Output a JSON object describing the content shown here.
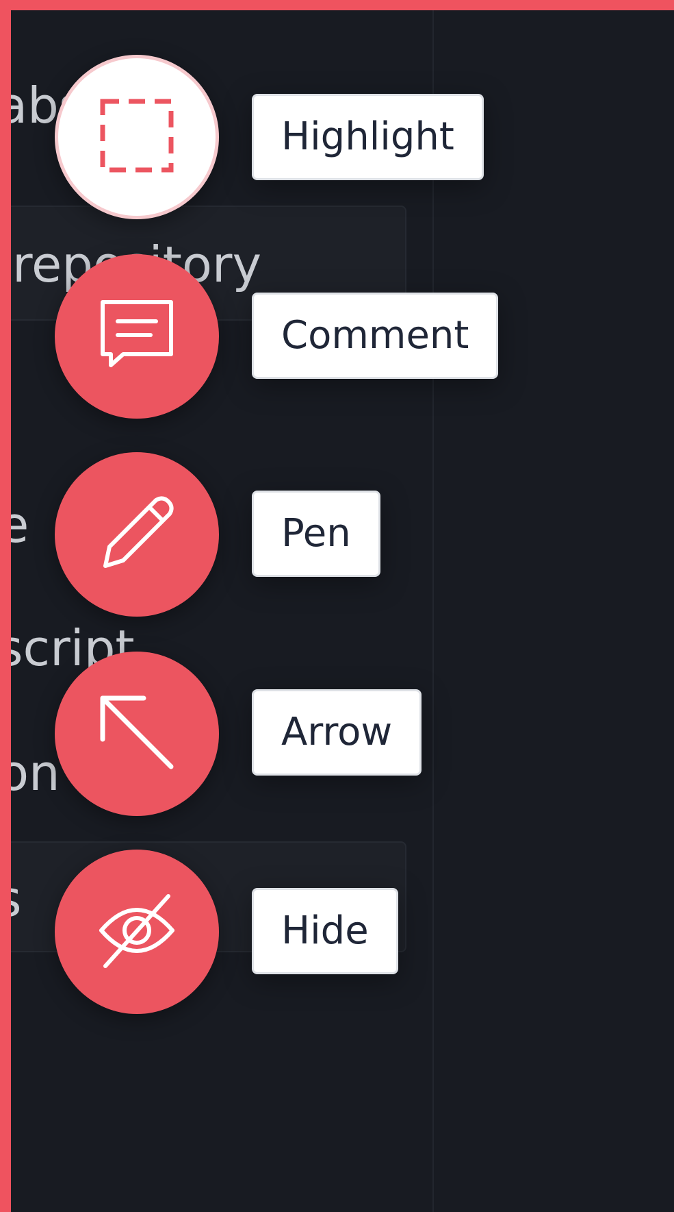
{
  "background": {
    "fragments": [
      "abs",
      "repository",
      "e",
      "script",
      "on",
      "s"
    ]
  },
  "tools": [
    {
      "label": "Highlight",
      "icon": "highlight-select-icon",
      "active": true
    },
    {
      "label": "Comment",
      "icon": "comment-icon",
      "active": false
    },
    {
      "label": "Pen",
      "icon": "pen-icon",
      "active": false
    },
    {
      "label": "Arrow",
      "icon": "arrow-icon",
      "active": false
    },
    {
      "label": "Hide",
      "icon": "eye-off-icon",
      "active": false
    }
  ],
  "colors": {
    "accent": "#ec5560",
    "frame": "#ef535f",
    "background": "#181b22",
    "label_text": "#1f2637"
  }
}
